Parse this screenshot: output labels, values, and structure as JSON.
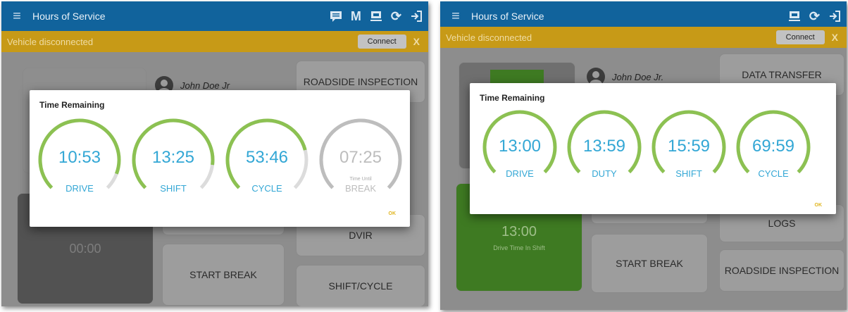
{
  "left": {
    "app_title": "Hours of Service",
    "banner": {
      "message": "Vehicle disconnected",
      "connect_label": "Connect",
      "close_label": "X"
    },
    "driver_name": "John Doe Jr",
    "tiles": {
      "roadside_inspection": "ROADSIDE INSPECTION",
      "dvir": "DVIR",
      "start_break": "START BREAK",
      "shift_cycle": "SHIFT/CYCLE",
      "timer": "00:00"
    },
    "dialog": {
      "title": "Time Remaining",
      "ok_label": "OK",
      "gauges": [
        {
          "value": "10:53",
          "label": "DRIVE",
          "color": "#8cc152",
          "fraction": 0.91,
          "sub": ""
        },
        {
          "value": "13:25",
          "label": "SHIFT",
          "color": "#8cc152",
          "fraction": 0.86,
          "sub": ""
        },
        {
          "value": "53:46",
          "label": "CYCLE",
          "color": "#8cc152",
          "fraction": 0.78,
          "sub": ""
        },
        {
          "value": "07:25",
          "label": "BREAK",
          "color": "#bdbdbd",
          "fraction": 1.0,
          "sub": "Time Until"
        }
      ]
    }
  },
  "right": {
    "app_title": "Hours of Service",
    "banner": {
      "message": "Vehicle disconnected",
      "connect_label": "Connect",
      "close_label": "X"
    },
    "driver_name": "John Doe Jr.",
    "tiles": {
      "data_transfer": "DATA TRANSFER",
      "logs": "LOGS",
      "start_break": "START BREAK",
      "roadside_inspection": "ROADSIDE INSPECTION",
      "drive_time": "13:00",
      "drive_time_label": "Drive Time In Shift"
    },
    "dialog": {
      "title": "Time Remaining",
      "ok_label": "OK",
      "gauges": [
        {
          "value": "13:00",
          "label": "DRIVE",
          "color": "#8cc152",
          "fraction": 1.0
        },
        {
          "value": "13:59",
          "label": "DUTY",
          "color": "#8cc152",
          "fraction": 1.0
        },
        {
          "value": "15:59",
          "label": "SHIFT",
          "color": "#8cc152",
          "fraction": 1.0
        },
        {
          "value": "69:59",
          "label": "CYCLE",
          "color": "#8cc152",
          "fraction": 1.0
        }
      ]
    }
  },
  "colors": {
    "topbar": "#11639c",
    "banner": "#c79a17",
    "value_text": "#33a7d5",
    "ok_text": "#e0b51f"
  }
}
